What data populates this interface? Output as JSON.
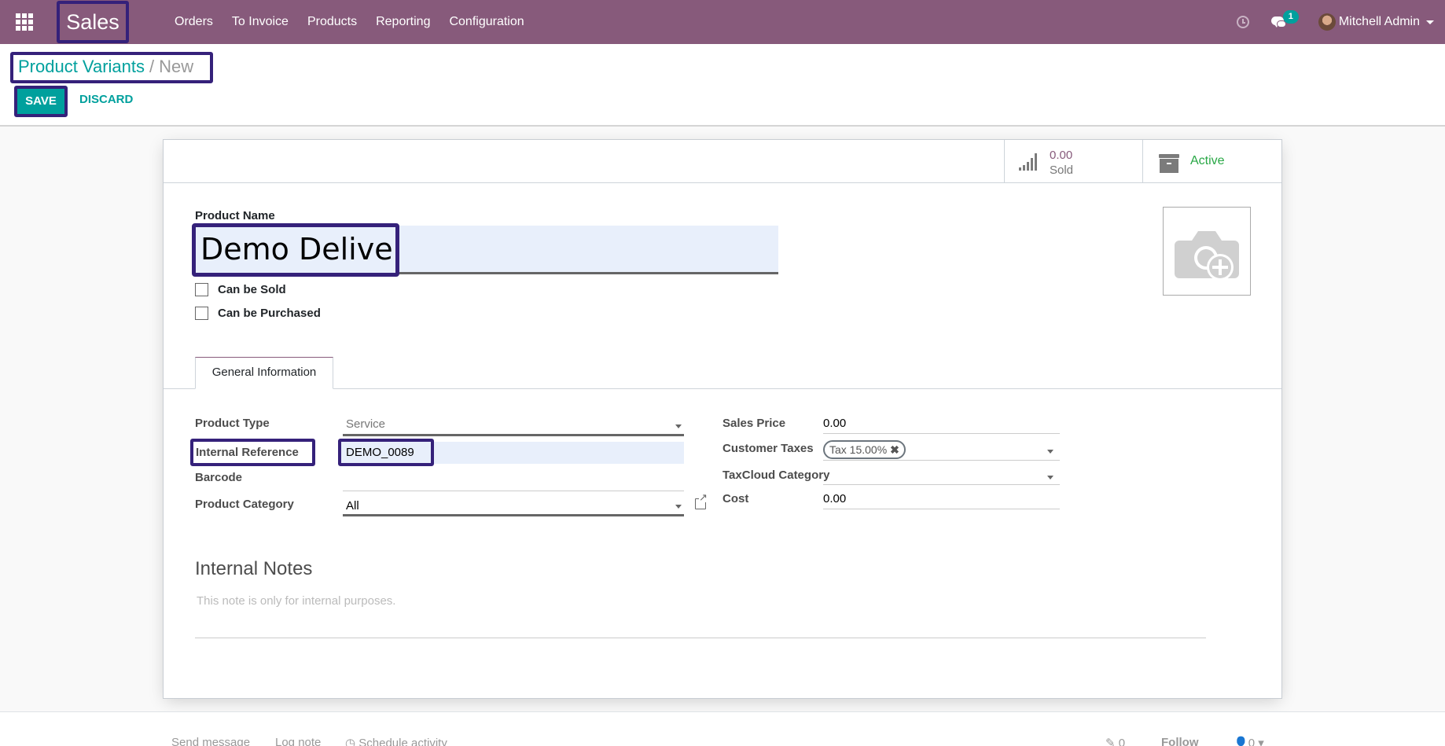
{
  "navbar": {
    "app_name": "Sales",
    "menu": [
      "Orders",
      "To Invoice",
      "Products",
      "Reporting",
      "Configuration"
    ],
    "messages_badge": "1",
    "user_name": "Mitchell Admin"
  },
  "breadcrumb": {
    "parent": "Product Variants",
    "separator": "/",
    "current": "New"
  },
  "actions": {
    "save_label": "SAVE",
    "discard_label": "DISCARD"
  },
  "stats": {
    "sold_value": "0.00",
    "sold_label": "Sold",
    "active_label": "Active"
  },
  "product": {
    "name_label": "Product Name",
    "name_value": "Demo Delivery",
    "can_be_sold_label": "Can be Sold",
    "can_be_sold": false,
    "can_be_purchased_label": "Can be Purchased",
    "can_be_purchased": false
  },
  "tabs": [
    {
      "label": "General Information",
      "active": true
    }
  ],
  "general": {
    "left": {
      "product_type_label": "Product Type",
      "product_type_value": "Service",
      "internal_reference_label": "Internal Reference",
      "internal_reference_value": "DEMO_0089",
      "barcode_label": "Barcode",
      "barcode_value": "",
      "product_category_label": "Product Category",
      "product_category_value": "All"
    },
    "right": {
      "sales_price_label": "Sales Price",
      "sales_price_value": "0.00",
      "customer_taxes_label": "Customer Taxes",
      "customer_taxes_tags": [
        "Tax 15.00%"
      ],
      "taxcloud_category_label": "TaxCloud Category",
      "taxcloud_category_value": "",
      "cost_label": "Cost",
      "cost_value": "0.00"
    }
  },
  "notes": {
    "title": "Internal Notes",
    "placeholder": "This note is only for internal purposes."
  },
  "chatter": {
    "send_message": "Send message",
    "log_note": "Log note",
    "schedule_activity": "Schedule activity",
    "attachments_count": "0",
    "follow_label": "Follow",
    "followers_count": "0"
  },
  "colors": {
    "brand": "#875a7b",
    "accent": "#00a09d",
    "active_green": "#28a745",
    "highlight_border": "#35217a"
  }
}
